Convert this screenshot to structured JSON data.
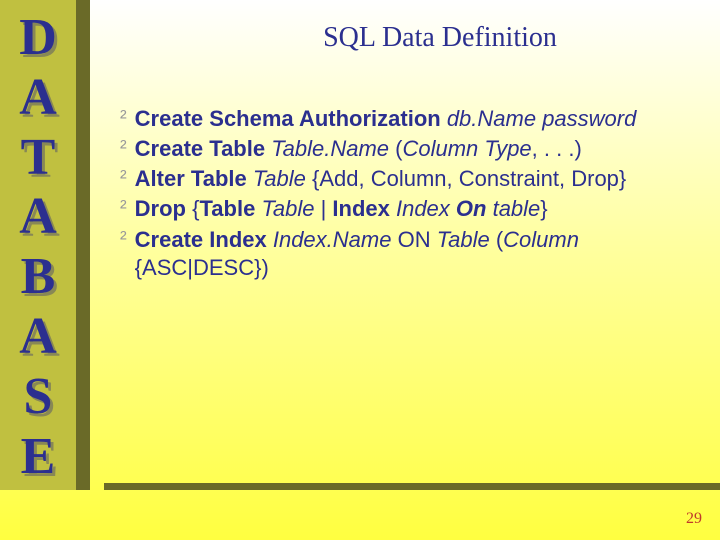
{
  "sidebar": {
    "letters": [
      "D",
      "A",
      "T",
      "A",
      "B",
      "A",
      "S",
      "E"
    ]
  },
  "title": "SQL Data Definition",
  "bullets": {
    "b0": {
      "bold0": "Create Schema Authorization ",
      "ital0": "db.Name password"
    },
    "b1": {
      "bold0": "Create Table ",
      "ital0": "Table.Name ",
      "plain0": "(",
      "ital1": "Column  Type",
      "plain1": ", . . .)"
    },
    "b2": {
      "bold0": "Alter Table ",
      "ital0": "Table ",
      "plain0": "{Add, Column, Constraint, Drop}"
    },
    "b3": {
      "bold0": "Drop ",
      "plain0": "{",
      "bold1": "Table ",
      "ital0": "Table ",
      "plain1": "| ",
      "bold2": "Index ",
      "ital1": "Index ",
      "boldital0": "On ",
      "ital2": "table",
      "plain2": "}"
    },
    "b4": {
      "bold0": "Create Index ",
      "ital0": "Index.Name",
      "plain0": " ON ",
      "ital1": "Table ",
      "plain1": "(",
      "ital2": "Column ",
      "plain2": "{ASC|DESC})"
    }
  },
  "page_number": "29",
  "bullet_glyph": "²"
}
